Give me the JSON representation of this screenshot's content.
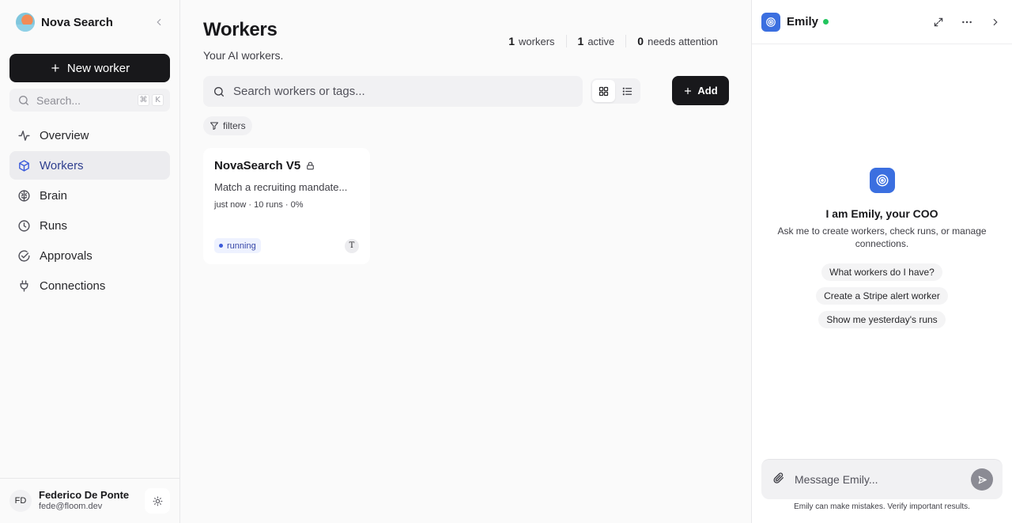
{
  "sidebar": {
    "brand": "Nova Search",
    "new_worker_label": "New worker",
    "search_placeholder": "Search...",
    "search_shortcut": [
      "⌘",
      "K"
    ],
    "nav": [
      {
        "label": "Overview",
        "icon": "activity-icon"
      },
      {
        "label": "Workers",
        "icon": "cube-icon",
        "active": true
      },
      {
        "label": "Brain",
        "icon": "brain-icon"
      },
      {
        "label": "Runs",
        "icon": "clock-icon"
      },
      {
        "label": "Approvals",
        "icon": "check-circle-icon"
      },
      {
        "label": "Connections",
        "icon": "plug-icon"
      }
    ],
    "user": {
      "initials": "FD",
      "name": "Federico De Ponte",
      "email": "fede@floom.dev"
    }
  },
  "main": {
    "title": "Workers",
    "subtitle": "Your AI workers.",
    "stats": [
      {
        "value": "1",
        "label": "workers"
      },
      {
        "value": "1",
        "label": "active"
      },
      {
        "value": "0",
        "label": "needs attention"
      }
    ],
    "search_placeholder": "Search workers or tags...",
    "add_label": "Add",
    "filters_label": "filters",
    "workers": [
      {
        "name": "NovaSearch V5",
        "description": "Match a recruiting mandate...",
        "meta": "just now · 10 runs · 0%",
        "status": "running",
        "tool_initial": "T"
      }
    ]
  },
  "chat": {
    "name": "Emily",
    "status_color": "#22c55e",
    "greeting_title": "I am Emily, your COO",
    "greeting_sub": "Ask me to create workers, check runs, or manage connections.",
    "suggestions": [
      "What workers do I have?",
      "Create a Stripe alert worker",
      "Show me yesterday's runs"
    ],
    "input_placeholder": "Message Emily...",
    "disclaimer": "Emily can make mistakes. Verify important results."
  },
  "colors": {
    "accent": "#3b6fe0",
    "primary_button": "#18181b",
    "running_badge": "#3848a8"
  }
}
